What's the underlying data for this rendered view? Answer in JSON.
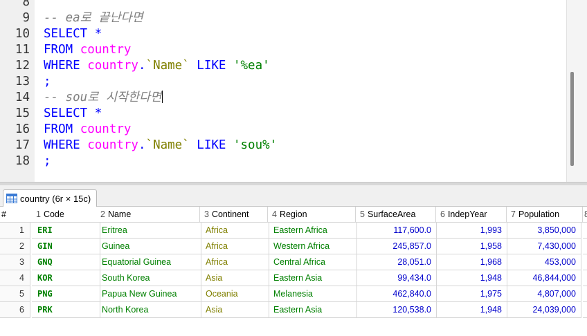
{
  "editor": {
    "lines": [
      {
        "no": "8",
        "tokens": []
      },
      {
        "no": "9",
        "tokens": [
          {
            "t": "-- ea로 끝난다면",
            "c": "cmt"
          }
        ]
      },
      {
        "no": "10",
        "tokens": [
          {
            "t": "SELECT *",
            "c": "kw"
          }
        ]
      },
      {
        "no": "11",
        "tokens": [
          {
            "t": "FROM ",
            "c": "kw"
          },
          {
            "t": "country",
            "c": "tbl"
          }
        ]
      },
      {
        "no": "12",
        "tokens": [
          {
            "t": "WHERE ",
            "c": "kw"
          },
          {
            "t": "country",
            "c": "tbl"
          },
          {
            "t": ".",
            "c": "kw"
          },
          {
            "t": "`Name`",
            "c": "fld"
          },
          {
            "t": " LIKE ",
            "c": "kw"
          },
          {
            "t": "'%ea'",
            "c": "str"
          }
        ]
      },
      {
        "no": "13",
        "tokens": [
          {
            "t": ";",
            "c": "kw"
          }
        ]
      },
      {
        "no": "14",
        "tokens": [
          {
            "t": "-- sou로 시작한다면",
            "c": "cmt"
          }
        ],
        "caret": true
      },
      {
        "no": "15",
        "tokens": [
          {
            "t": "SELECT *",
            "c": "kw"
          }
        ]
      },
      {
        "no": "16",
        "tokens": [
          {
            "t": "FROM ",
            "c": "kw"
          },
          {
            "t": "country",
            "c": "tbl"
          }
        ]
      },
      {
        "no": "17",
        "tokens": [
          {
            "t": "WHERE ",
            "c": "kw"
          },
          {
            "t": "country",
            "c": "tbl"
          },
          {
            "t": ".",
            "c": "kw"
          },
          {
            "t": "`Name`",
            "c": "fld"
          },
          {
            "t": " LIKE ",
            "c": "kw"
          },
          {
            "t": "'sou%'",
            "c": "str"
          }
        ]
      },
      {
        "no": "18",
        "tokens": [
          {
            "t": ";",
            "c": "kw"
          }
        ]
      }
    ]
  },
  "result_tab": {
    "label": "country (6r × 15c)"
  },
  "grid": {
    "row_header": "#",
    "columns": [
      {
        "num": "1",
        "name": "Code",
        "key": true
      },
      {
        "num": "2",
        "name": "Name"
      },
      {
        "num": "3",
        "name": "Continent"
      },
      {
        "num": "4",
        "name": "Region"
      },
      {
        "num": "5",
        "name": "SurfaceArea"
      },
      {
        "num": "6",
        "name": "IndepYear"
      },
      {
        "num": "7",
        "name": "Population"
      },
      {
        "num": "8",
        "name": ""
      }
    ],
    "rows": [
      {
        "n": "1",
        "code": "ERI",
        "name": "Eritrea",
        "continent": "Africa",
        "region": "Eastern Africa",
        "surface": "117,600.0",
        "indep": "1,993",
        "pop": "3,850,000"
      },
      {
        "n": "2",
        "code": "GIN",
        "name": "Guinea",
        "continent": "Africa",
        "region": "Western Africa",
        "surface": "245,857.0",
        "indep": "1,958",
        "pop": "7,430,000"
      },
      {
        "n": "3",
        "code": "GNQ",
        "name": "Equatorial Guinea",
        "continent": "Africa",
        "region": "Central Africa",
        "surface": "28,051.0",
        "indep": "1,968",
        "pop": "453,000"
      },
      {
        "n": "4",
        "code": "KOR",
        "name": "South Korea",
        "continent": "Asia",
        "region": "Eastern Asia",
        "surface": "99,434.0",
        "indep": "1,948",
        "pop": "46,844,000"
      },
      {
        "n": "5",
        "code": "PNG",
        "name": "Papua New Guinea",
        "continent": "Oceania",
        "region": "Melanesia",
        "surface": "462,840.0",
        "indep": "1,975",
        "pop": "4,807,000"
      },
      {
        "n": "6",
        "code": "PRK",
        "name": "North Korea",
        "continent": "Asia",
        "region": "Eastern Asia",
        "surface": "120,538.0",
        "indep": "1,948",
        "pop": "24,039,000"
      }
    ]
  }
}
